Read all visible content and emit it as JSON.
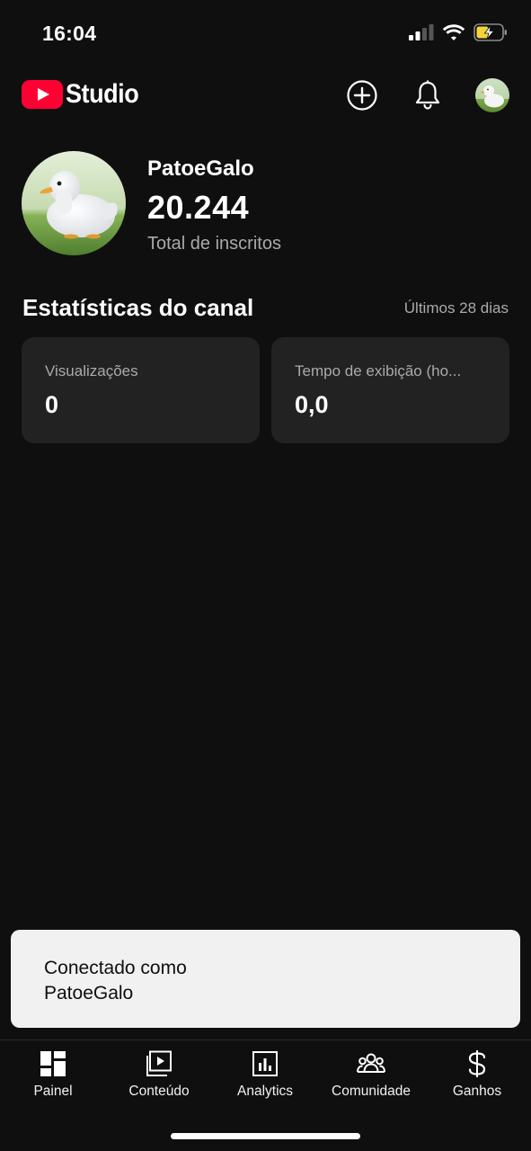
{
  "status_bar": {
    "time": "16:04",
    "icons": [
      "cellular-signal-icon",
      "wifi-icon",
      "battery-charging-icon"
    ]
  },
  "header": {
    "logo_text": "Studio",
    "icons": [
      "youtube-logo-icon",
      "create-icon",
      "notifications-icon",
      "channel-avatar-icon"
    ]
  },
  "channel": {
    "name": "PatoeGalo",
    "subscribers": "20.244",
    "subscribers_label": "Total de inscritos"
  },
  "stats": {
    "title": "Estatísticas do canal",
    "period": "Últimos 28 dias",
    "cards": [
      {
        "label": "Visualizações",
        "value": "0"
      },
      {
        "label": "Tempo de exibição (ho...",
        "value": "0,0"
      }
    ]
  },
  "snackbar": {
    "line1": "Conectado como",
    "line2": "PatoeGalo"
  },
  "bottom_nav": {
    "items": [
      {
        "label": "Painel",
        "icon": "dashboard-icon"
      },
      {
        "label": "Conteúdo",
        "icon": "content-icon"
      },
      {
        "label": "Analytics",
        "icon": "analytics-icon"
      },
      {
        "label": "Comunidade",
        "icon": "community-icon"
      },
      {
        "label": "Ganhos",
        "icon": "earn-icon"
      }
    ]
  },
  "colors": {
    "background": "#0f0f0f",
    "card": "#222222",
    "youtube_red": "#ff0033",
    "secondary_text": "#aaaaaa",
    "snackbar_bg": "#f1f1f1",
    "battery_yellow": "#f5d33a"
  }
}
